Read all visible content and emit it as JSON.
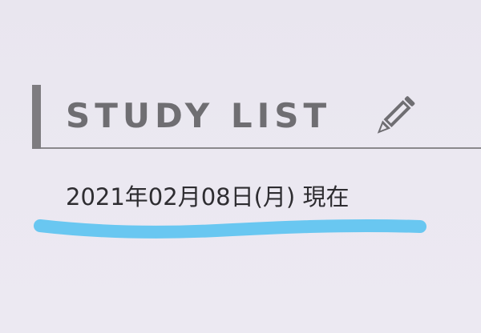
{
  "heading": {
    "title": "STUDY LIST",
    "icon": "pencil-icon"
  },
  "date_text": "2021年02月08日(月) 現在",
  "colors": {
    "background": "#ebe8f0",
    "heading_text": "#6f6e72",
    "heading_bar": "#7e7c80",
    "highlight": "#69c7f1"
  }
}
